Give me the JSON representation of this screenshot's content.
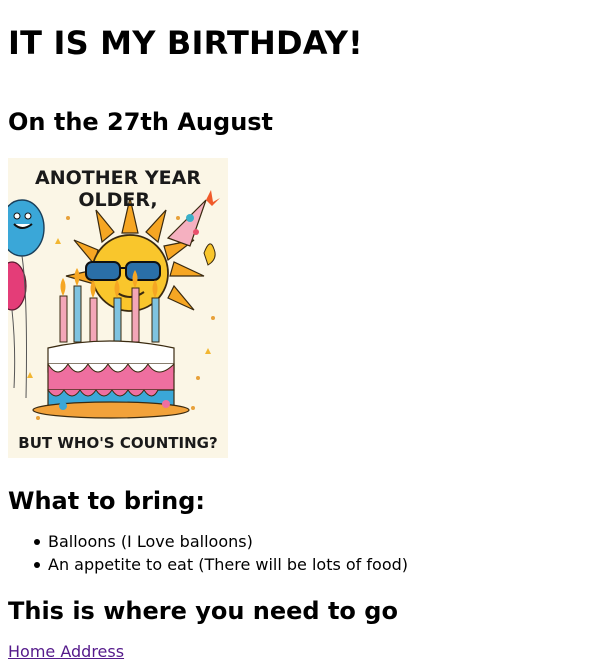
{
  "page": {
    "title": "IT IS MY BIRTHDAY!",
    "date_heading": "On the 27th August",
    "image": {
      "top_text_line1": "ANOTHER YEAR",
      "top_text_line2": "OLDER,",
      "bottom_text": "BUT WHO'S COUNTING?"
    },
    "bring_heading": "What to bring:",
    "bring_items": [
      "Balloons (I Love balloons)",
      "An appetite to eat (There will be lots of food)"
    ],
    "directions_heading": "This is where you need to go",
    "address_link": "Home Address"
  },
  "colors": {
    "link": "#551a8b",
    "text": "#000000",
    "card_background": "#fbf6e6"
  }
}
